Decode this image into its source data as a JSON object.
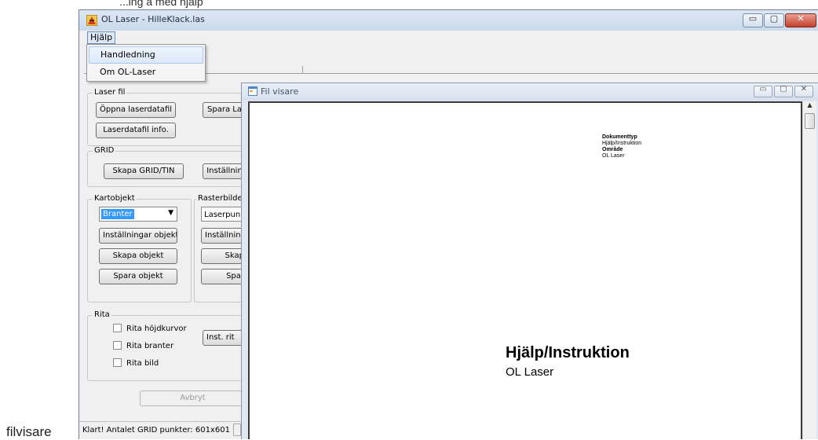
{
  "document": {
    "top_text": "...ing a med hjälp",
    "caption": "filvisare"
  },
  "app": {
    "title": "OL Laser - HilleKlack.las",
    "window_buttons": {
      "minimize": "▭",
      "maximize": "▢",
      "close": "✕"
    },
    "menu": {
      "hjalp": "Hjälp"
    },
    "dropdown": {
      "items": [
        "Handledning",
        "Om OL-Laser"
      ]
    },
    "groups": {
      "laser_fil": {
        "label": "Laser fil",
        "open_btn": "Öppna laserdatafil",
        "save_btn": "Spara La",
        "info_btn": "Laserdatafil info."
      },
      "grid": {
        "label": "GRID",
        "create_btn": "Skapa GRID/TIN",
        "settings_btn": "Inställnin"
      },
      "kartobjekt": {
        "label": "Kartobjekt",
        "combo_value": "Branter",
        "settings_btn": "Inställningar objekt",
        "create_btn": "Skapa objekt",
        "save_btn": "Spara objekt"
      },
      "rasterbilder": {
        "label": "Rasterbilde",
        "combo_value": "Laserpunk",
        "settings_btn": "Inställnin",
        "create_btn": "Skap",
        "save_btn": "Spar"
      },
      "rita": {
        "label": "Rita",
        "chk_hojdkurvor": "Rita höjdkurvor",
        "chk_branter": "Rita branter",
        "chk_bild": "Rita bild",
        "inst_btn": "Inst. rit"
      }
    },
    "cancel_btn": "Avbryt",
    "status": "Klart! Antalet GRID punkter: 601x601"
  },
  "viewer": {
    "title": "Fil visare",
    "page": {
      "meta_label1": "Dokumenttyp",
      "meta_value1": "Hjälp/Instruktion",
      "meta_label2": "Område",
      "meta_value2": "OL Laser",
      "title": "Hjälp/Instruktion",
      "subtitle": "OL Laser"
    }
  },
  "colors": {
    "accent_selection": "#3399ff",
    "close_button": "#c4402a",
    "window_frame": "#dde8f6"
  }
}
